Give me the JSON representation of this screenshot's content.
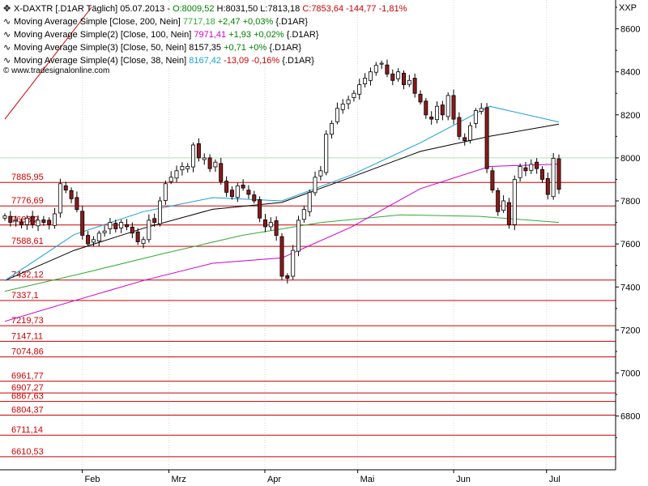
{
  "header": {
    "title_prefix": "X-DAXTR [.D1AR  Täglich] 05.07.2013 - ",
    "ohlc": [
      {
        "text": "O:8009,52",
        "color": "#008000"
      },
      {
        "text": " H:8031,50 L:7813,18 ",
        "color": "#000000"
      },
      {
        "text": "C:7853,64 -144,77 -1,81%",
        "color": "#cc0000"
      }
    ],
    "indicators": [
      {
        "label": "Moving Average Simple [Close, 200, Nein]",
        "value": "7717,18",
        "value_color": "#33aa33",
        "change": "+2,47 +0,03%",
        "change_color": "#008000",
        "suffix": "{.D1AR}"
      },
      {
        "label": "Moving Average Simple(2) [Close, 100, Nein]",
        "value": "7971,41",
        "value_color": "#cc00cc",
        "change": "+1,93 +0,02%",
        "change_color": "#008000",
        "suffix": "{.D1AR}"
      },
      {
        "label": "Moving Average Simple(3) [Close, 50, Nein]",
        "value": "8157,35",
        "value_color": "#000000",
        "change": "+0,71 +0%",
        "change_color": "#008000",
        "suffix": "{.D1AR}"
      },
      {
        "label": "Moving Average Simple(4) [Close, 38, Nein]",
        "value": "8167,42",
        "value_color": "#1a9ed6",
        "change": "-13,09 -0,16%",
        "change_color": "#cc0000",
        "suffix": "{.D1AR}"
      }
    ],
    "watermark": "© www.tradesignalonline.com"
  },
  "axis_corner_label": "XXP",
  "colors": {
    "bull": "#ffffff",
    "bear": "#8b1a1a",
    "level_line": "#cc0000",
    "level_text": "#cc0000",
    "ma200": "#33aa33",
    "ma100": "#cc00cc",
    "ma50": "#000000",
    "ma38": "#1a9ed6",
    "trend": "#cc0000",
    "grid": "#d6d6d6",
    "hline": "#b5e0b5"
  },
  "chart_data": {
    "type": "candlestick",
    "y_axis": {
      "min": 6550,
      "max": 8700,
      "ticks": [
        6800,
        7000,
        7200,
        7400,
        7600,
        7800,
        8000,
        8200,
        8400,
        8600
      ]
    },
    "x_axis": {
      "months": [
        {
          "label": "Feb",
          "date": "2013-02-01"
        },
        {
          "label": "Mrz",
          "date": "2013-03-01"
        },
        {
          "label": "Apr",
          "date": "2013-04-01"
        },
        {
          "label": "Mai",
          "date": "2013-05-01"
        },
        {
          "label": "Jun",
          "date": "2013-06-01"
        },
        {
          "label": "Jul",
          "date": "2013-07-01"
        }
      ]
    },
    "dates_start": "2013-01-07",
    "dates_end": "2013-07-05",
    "levels": [
      "7885,95",
      "7776,69",
      "7688,2",
      "7588,61",
      "7432,12",
      "7337,1",
      "7219,73",
      "7147,11",
      "7074,86",
      "6961,77",
      "6907,27",
      "6867,63",
      "6804,37",
      "6711,14",
      "6610,53"
    ],
    "level_values": [
      7885.95,
      7776.69,
      7688.2,
      7588.61,
      7432.12,
      7337.1,
      7219.73,
      7147.11,
      7074.86,
      6961.77,
      6907.27,
      6867.63,
      6804.37,
      6711.14,
      6610.53
    ],
    "reference_line": 8000,
    "trendline": [
      {
        "date": "2013-01-07",
        "value": 8180
      },
      {
        "date": "2013-02-04",
        "value": 8700
      }
    ],
    "close": [
      7730,
      7700,
      7710,
      7690,
      7720,
      7690,
      7710,
      7700,
      7690,
      7740,
      7880,
      7850,
      7810,
      7760,
      7640,
      7600,
      7620,
      7650,
      7660,
      7700,
      7670,
      7700,
      7680,
      7650,
      7610,
      7620,
      7710,
      7700,
      7800,
      7880,
      7910,
      7940,
      7960,
      7960,
      8060,
      8000,
      8000,
      7950,
      7980,
      7890,
      7840,
      7820,
      7870,
      7860,
      7830,
      7800,
      7720,
      7680,
      7700,
      7640,
      7450,
      7440,
      7570,
      7710,
      7760,
      7840,
      7910,
      7940,
      8110,
      8160,
      8230,
      8250,
      8270,
      8300,
      8340,
      8370,
      8400,
      8430,
      8440,
      8390,
      8360,
      8400,
      8340,
      8360,
      8300,
      8260,
      8200,
      8180,
      8240,
      8200,
      8290,
      8180,
      8100,
      8080,
      8150,
      8220,
      8230,
      7950,
      7850,
      7750,
      7800,
      7690,
      7900,
      7960,
      7940,
      7970,
      7950,
      7900,
      7830,
      7998,
      7854
    ],
    "ma200": [
      7380,
      7465,
      7555,
      7640,
      7700,
      7735,
      7728,
      7700
    ],
    "ma100": [
      7240,
      7336,
      7430,
      7510,
      7535,
      7678,
      7857,
      7960,
      7971
    ],
    "ma50": [
      7430,
      7570,
      7673,
      7761,
      7793,
      7910,
      8030,
      8100,
      8157
    ],
    "ma38": [
      7430,
      7643,
      7750,
      7815,
      7800,
      7920,
      8070,
      8240,
      8167
    ]
  }
}
